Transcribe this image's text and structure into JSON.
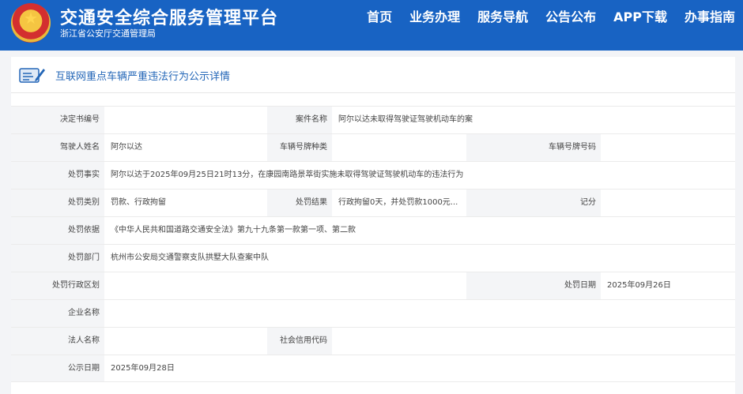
{
  "header": {
    "title": "交通安全综合服务管理平台",
    "subtitle": "浙江省公安厅交通管理局",
    "nav": [
      "首页",
      "业务办理",
      "服务导航",
      "公告公布",
      "APP下载",
      "办事指南"
    ]
  },
  "panel": {
    "title": "互联网重点车辆严重违法行为公示详情"
  },
  "details": {
    "decision_no_label": "决定书编号",
    "decision_no": "",
    "case_name_label": "案件名称",
    "case_name": "阿尔以达未取得驾驶证驾驶机动车的案",
    "driver_label": "驾驶人姓名",
    "driver": "阿尔以达",
    "plate_type_label": "车辆号牌种类",
    "plate_type": "",
    "plate_no_label": "车辆号牌号码",
    "plate_no": "",
    "facts_label": "处罚事实",
    "facts": "阿尔以达于2025年09月25日21时13分，在康园南路景萃街实施未取得驾驶证驾驶机动车的违法行为",
    "category_label": "处罚类别",
    "category": "罚款、行政拘留",
    "result_label": "处罚结果",
    "result": "行政拘留0天，并处罚款1000元...",
    "points_label": "记分",
    "points": "",
    "basis_label": "处罚依据",
    "basis": "《中华人民共和国道路交通安全法》第九十九条第一款第一项、第二款",
    "dept_label": "处罚部门",
    "dept": "杭州市公安局交通警察支队拱墅大队查案中队",
    "region_label": "处罚行政区划",
    "region": "",
    "date_label": "处罚日期",
    "date": "2025年09月26日",
    "company_label": "企业名称",
    "company": "",
    "legal_label": "法人名称",
    "legal": "",
    "credit_label": "社会信用代码",
    "credit": "",
    "pub_date_label": "公示日期",
    "pub_date": "2025年09月28日"
  },
  "colors": {
    "header_bg": "#1863c3",
    "accent": "#2366b7",
    "label_bg": "#f4f5f7"
  }
}
